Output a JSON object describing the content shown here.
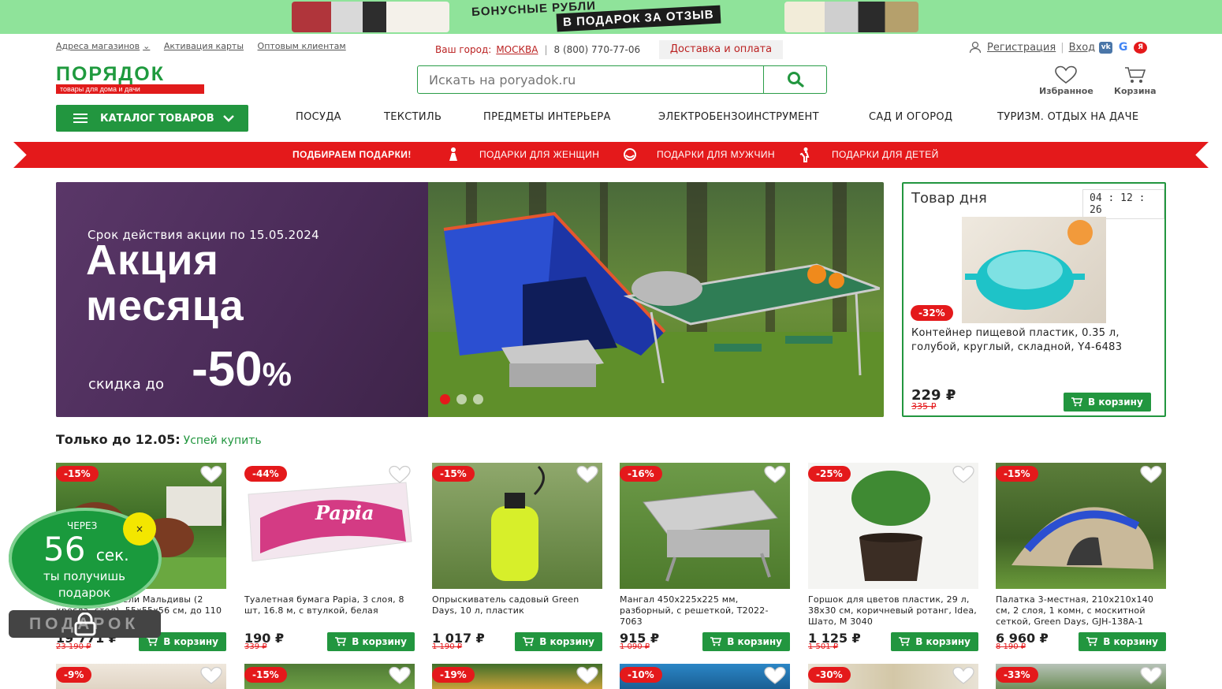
{
  "promo_strip": {
    "line1": "БОНУСНЫЕ РУБЛИ",
    "line2": "В ПОДАРОК ЗА ОТЗЫВ"
  },
  "header": {
    "links": [
      "Адреса магазинов",
      "Активация карты",
      "Оптовым клиентам"
    ],
    "city_label": "Ваш город:",
    "city": "МОСКВА",
    "phone": "8 (800) 770-77-06",
    "delivery": "Доставка и оплата",
    "register": "Регистрация",
    "login": "Вход",
    "social": [
      {
        "name": "vk",
        "label": "vk",
        "color": "#4a76a8"
      },
      {
        "name": "google",
        "label": "G",
        "color": "#4285f4"
      },
      {
        "name": "yandex",
        "label": "Я",
        "color": "#e4191b"
      }
    ],
    "logo": "ПОРЯДОК",
    "logo_tagline": "товары для дома и дачи",
    "search_placeholder": "Искать на poryadok.ru",
    "favorites": "Избранное",
    "cart": "Корзина"
  },
  "nav": {
    "catalog": "КАТАЛОГ ТОВАРОВ",
    "items": [
      "ПОСУДА",
      "ТЕКСТИЛЬ",
      "ПРЕДМЕТЫ ИНТЕРЬЕРА",
      "ЭЛЕКТРОБЕНЗОИНСТРУМЕНТ",
      "САД И ОГОРОД",
      "ТУРИЗМ. ОТДЫХ НА ДАЧЕ"
    ]
  },
  "ribbon": {
    "lead": "ПОДБИРАЕМ ПОДАРКИ!",
    "women": "ПОДАРКИ ДЛЯ ЖЕНЩИН",
    "men": "ПОДАРКИ ДЛЯ МУЖЧИН",
    "kids": "ПОДАРКИ ДЛЯ ДЕТЕЙ",
    "color": "#e4191b"
  },
  "banner": {
    "validity": "Срок действия акции по 15.05.2024",
    "title_line1": "Акция",
    "title_line2": "месяца",
    "discount_prefix": "скидка до",
    "discount_value": "-50",
    "discount_unit": "%"
  },
  "deal": {
    "title": "Товар дня",
    "timer": "04 : 12 : 26",
    "badge": "-32%",
    "name": "Контейнер пищевой пластик, 0.35 л, голубой, круглый, складной, Y4-6483",
    "price": "229 ₽",
    "old_price": "335 ₽",
    "cart": "В корзину"
  },
  "section": {
    "title": "Только до 12.05:",
    "hurry": "Успей купить"
  },
  "products": [
    {
      "badge": "-15%",
      "name": "Комплект мебели Мальдивы (2 кресла, стол), 55x55x56 см, до 110 кг,",
      "price": "19 771 ₽",
      "old_price": "23 190 ₽",
      "cart": "В корзину"
    },
    {
      "badge": "-44%",
      "name": "Туалетная бумага Papia, 3 слоя, 8 шт, 16.8 м, с втулкой, белая",
      "price": "190 ₽",
      "old_price": "339 ₽",
      "cart": "В корзину"
    },
    {
      "badge": "-15%",
      "name": "Опрыскиватель садовый Green Days, 10 л, пластик",
      "price": "1 017 ₽",
      "old_price": "1 190 ₽",
      "cart": "В корзину"
    },
    {
      "badge": "-16%",
      "name": "Мангал 450х225х225 мм, разборный, с решеткой, T2022-7063",
      "price": "915 ₽",
      "old_price": "1 090 ₽",
      "cart": "В корзину"
    },
    {
      "badge": "-25%",
      "name": "Горшок для цветов пластик, 29 л, 38х30 см, коричневый ротанг, Idea, Шато, М 3040",
      "price": "1 125 ₽",
      "old_price": "1 501 ₽",
      "cart": "В корзину"
    },
    {
      "badge": "-15%",
      "name": "Палатка 3-местная, 210х210х140 см, 2 слоя, 1 комн, с москитной сеткой, Green Days, GJH-138A-1",
      "price": "6 960 ₽",
      "old_price": "8 190 ₽",
      "cart": "В корзину"
    }
  ],
  "products_row2_badges": [
    "-9%",
    "-15%",
    "-19%",
    "-10%",
    "-30%",
    "-33%"
  ],
  "gift": {
    "through": "ЧЕРЕЗ",
    "seconds": "56",
    "sec_unit": "сек.",
    "text": "ты получишь подарок",
    "close": "×",
    "button": "ПОДАРОК"
  },
  "colors": {
    "brand_green": "#22963f",
    "accent_red": "#e4191b",
    "promo_green": "#8fe39a"
  }
}
